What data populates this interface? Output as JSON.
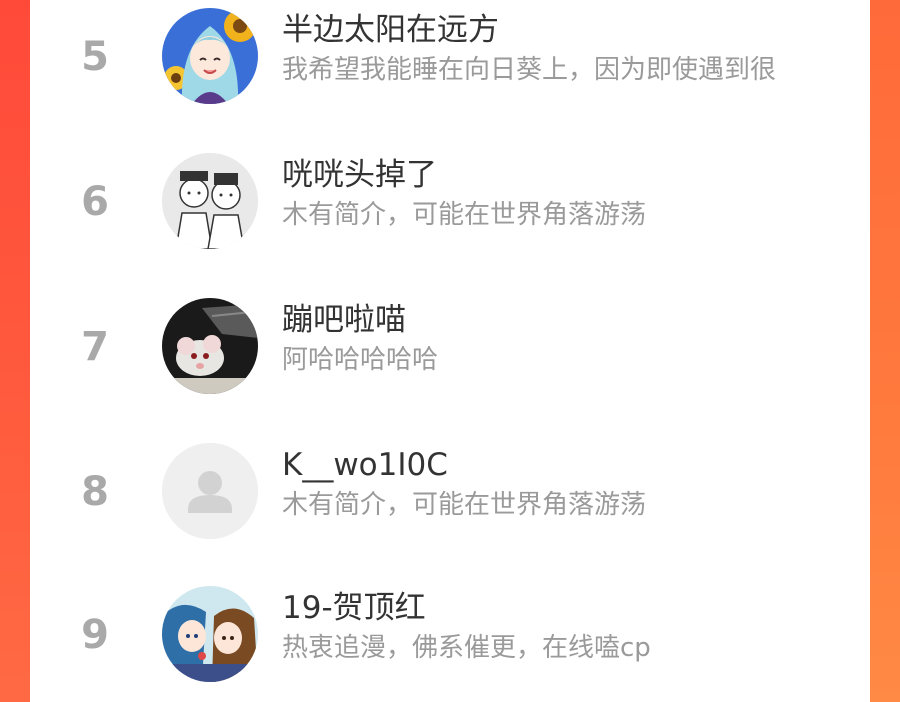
{
  "ranking": {
    "items": [
      {
        "rank": "5",
        "name": "半边太阳在远方",
        "bio": "我希望我能睡在向日葵上，因为即使遇到很",
        "avatar_icon": "anime-girl-sunflower-avatar"
      },
      {
        "rank": "6",
        "name": "咣咣头掉了",
        "bio": "木有简介，可能在世界角落游荡",
        "avatar_icon": "sketch-couple-avatar"
      },
      {
        "rank": "7",
        "name": "蹦吧啦喵",
        "bio": "阿哈哈哈哈哈",
        "avatar_icon": "rat-photo-avatar"
      },
      {
        "rank": "8",
        "name": "K__wo1I0C",
        "bio": "木有简介，可能在世界角落游荡",
        "avatar_icon": "default-user-icon"
      },
      {
        "rank": "9",
        "name": "19-贺顶红",
        "bio": "热衷追漫，佛系催更，在线嗑cp",
        "avatar_icon": "anime-couple-avatar"
      }
    ]
  },
  "colors": {
    "background_left": "#ff4a3a",
    "background_right": "#ff8a45",
    "card": "#ffffff",
    "rank_text": "#a9a9a9",
    "name_text": "#333333",
    "bio_text": "#9a9a9a"
  }
}
